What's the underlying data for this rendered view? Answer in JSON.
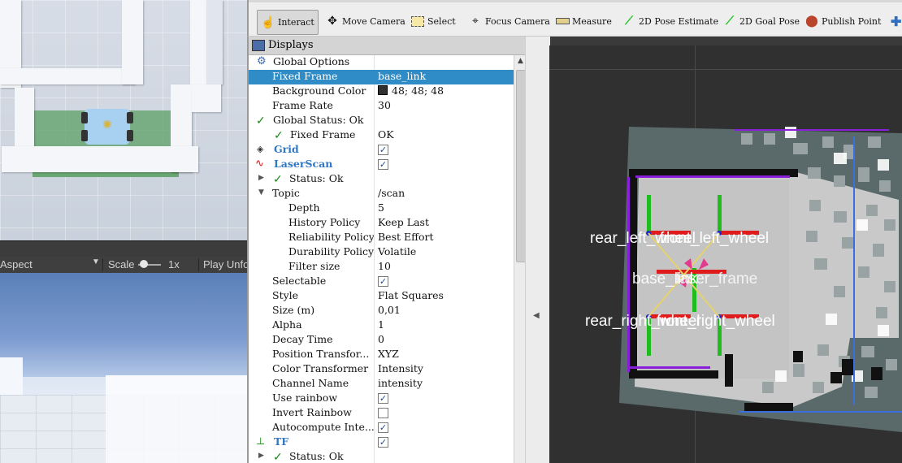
{
  "unity": {
    "aspect_label": "Aspect",
    "scale_label": "Scale",
    "scale_value": "1x",
    "play_label": "Play Unfo"
  },
  "toolbar": {
    "interact": "Interact",
    "move_camera": "Move Camera",
    "select": "Select",
    "focus_camera": "Focus Camera",
    "measure": "Measure",
    "pose_estimate": "2D Pose Estimate",
    "goal_pose": "2D Goal Pose",
    "publish_point": "Publish Point"
  },
  "displays": {
    "title": "Displays",
    "global_options": "Global Options",
    "fixed_frame_label": "Fixed Frame",
    "fixed_frame_value": "base_link",
    "background_color_label": "Background Color",
    "background_color_value": "48; 48; 48",
    "frame_rate_label": "Frame Rate",
    "frame_rate_value": "30",
    "global_status": "Global Status: Ok",
    "fixed_frame_status_label": "Fixed Frame",
    "fixed_frame_status_value": "OK",
    "grid": "Grid",
    "laserscan": "LaserScan",
    "laser_status": "Status: Ok",
    "topic_label": "Topic",
    "topic_value": "/scan",
    "depth_label": "Depth",
    "depth_value": "5",
    "history_label": "History Policy",
    "history_value": "Keep Last",
    "reliability_label": "Reliability Policy",
    "reliability_value": "Best Effort",
    "durability_label": "Durability Policy",
    "durability_value": "Volatile",
    "filter_label": "Filter size",
    "filter_value": "10",
    "selectable": "Selectable",
    "style_label": "Style",
    "style_value": "Flat Squares",
    "size_label": "Size (m)",
    "size_value": "0,01",
    "alpha_label": "Alpha",
    "alpha_value": "1",
    "decay_label": "Decay Time",
    "decay_value": "0",
    "position_transformer_label": "Position Transfor...",
    "position_transformer_value": "XYZ",
    "color_transformer_label": "Color Transformer",
    "color_transformer_value": "Intensity",
    "channel_label": "Channel Name",
    "channel_value": "intensity",
    "use_rainbow": "Use rainbow",
    "invert_rainbow": "Invert Rainbow",
    "autocompute": "Autocompute Inte...",
    "tf": "TF",
    "tf_status": "Status: Ok"
  },
  "view3d": {
    "labels": {
      "rear_left": "rear_left_wheel",
      "front_left": "front_left_wheel",
      "base": "base_link",
      "laser": "laser_frame",
      "rear_right": "rear_right_wheel",
      "front_right": "front_right_wheel"
    }
  },
  "colors": {
    "selection": "#308cc6",
    "background_3d": "#303030",
    "blue_display": "#2f78c3",
    "status_ok": "#1b8a1b",
    "laser_points": "#8a1fd9"
  }
}
